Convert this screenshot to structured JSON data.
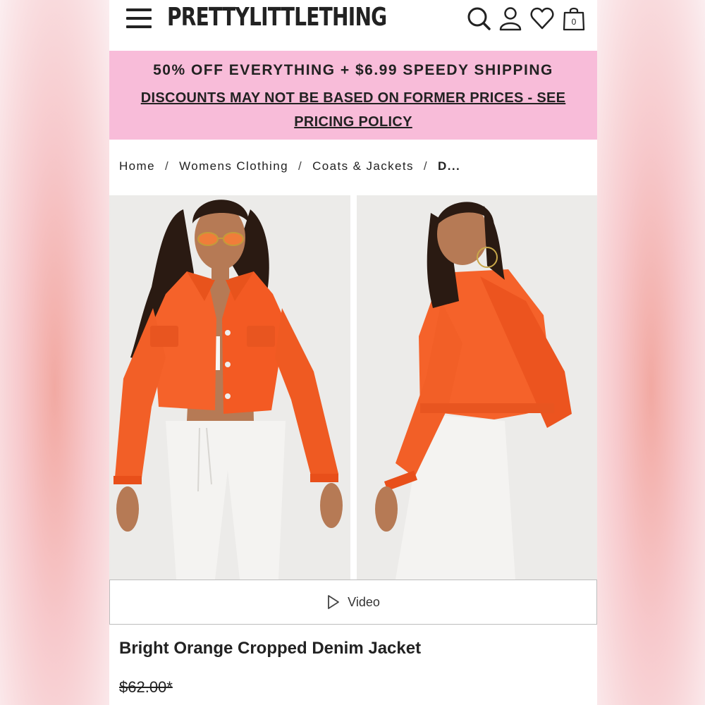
{
  "header": {
    "logo": "PRETTYLITTLETHING",
    "bag_count": "0",
    "icons": [
      "menu-icon",
      "search-icon",
      "account-icon",
      "heart-icon",
      "bag-icon"
    ]
  },
  "promo": {
    "line1": "50% OFF EVERYTHING + $6.99 SPEEDY SHIPPING",
    "line2": "DISCOUNTS MAY NOT BE BASED ON FORMER PRICES - SEE PRICING POLICY",
    "background": "#f8bcd9"
  },
  "breadcrumb": {
    "items": [
      "Home",
      "Womens Clothing",
      "Coats & Jackets"
    ],
    "current": "D...",
    "separator": "/"
  },
  "product": {
    "video_label": "Video",
    "title": "Bright Orange Cropped Denim Jacket",
    "price": "$62.00*",
    "jacket_color": "#f5622a"
  }
}
